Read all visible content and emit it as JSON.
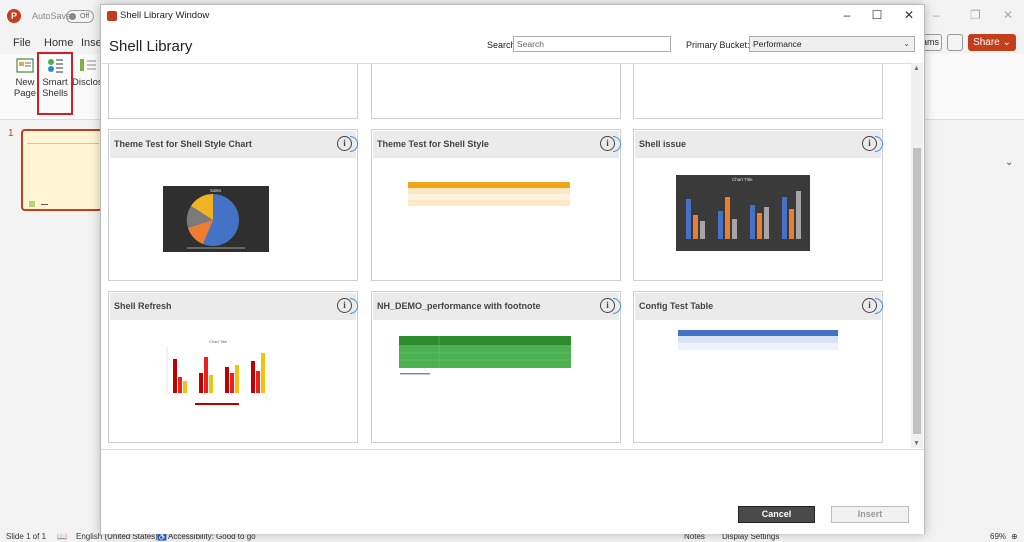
{
  "app": {
    "autosave_label": "AutoSave",
    "autosave_state": "Off",
    "share_label": "Share",
    "teams_label": "ams"
  },
  "menu": [
    "File",
    "Home",
    "Inse"
  ],
  "ribbon": {
    "new_page": "New Page",
    "smart_shells": "Smart Shells",
    "disclosure": "Disclos"
  },
  "slides": {
    "number": "1"
  },
  "dialog": {
    "window_title": "Shell Library Window",
    "heading": "Shell Library",
    "search_label": "Search:",
    "search_placeholder": "Search",
    "search_value": "",
    "bucket_label": "Primary Bucket:",
    "bucket_value": "Performance",
    "cards": [
      {
        "title": "Theme Test for Shell Style Chart",
        "thumb": "pie-chart",
        "thumb_title": "Sales"
      },
      {
        "title": "Theme Test for Shell Style",
        "thumb": "orange-table"
      },
      {
        "title": "Shell issue",
        "thumb": "bar-chart-dark",
        "thumb_title": "Chart Title"
      },
      {
        "title": "Shell Refresh",
        "thumb": "bar-chart-red",
        "thumb_title": "Chart Title"
      },
      {
        "title": "NH_DEMO_performance with footnote",
        "thumb": "green-table"
      },
      {
        "title": "Config Test Table",
        "thumb": "blue-table"
      }
    ],
    "cancel_label": "Cancel",
    "insert_label": "Insert"
  },
  "status": {
    "slide_info": "Slide 1 of 1",
    "language": "English (United States)",
    "accessibility": "Accessibility: Good to go",
    "notes": "Notes",
    "display_settings": "Display Settings",
    "zoom": "69%"
  },
  "colors": {
    "brand": "#c43e1c",
    "highlight": "#d21f26",
    "cancel_bg": "#4a4a4a"
  }
}
